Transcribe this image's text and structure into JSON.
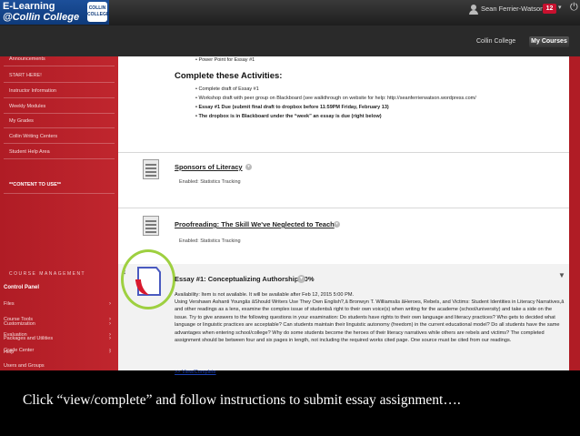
{
  "header": {
    "logo_line1": "E-Learning",
    "logo_line2": "@Collin College",
    "logo_seal_text": "COLLIN COLLEGE",
    "username": "Sean Ferrier-Watson",
    "notification_count": "12",
    "tabs": [
      {
        "label": "Collin College"
      },
      {
        "label": "My Courses"
      }
    ]
  },
  "sidebar": {
    "items": [
      {
        "label": "Announcements"
      },
      {
        "label": "START HERE!"
      },
      {
        "label": "Instructor Information"
      },
      {
        "label": "Weekly Modules"
      },
      {
        "label": "My Grades"
      },
      {
        "label": "Collin Writing Centers"
      },
      {
        "label": "Student Help Area"
      }
    ],
    "content_header": "**CONTENT TO USE**",
    "course_management_label": "COURSE MANAGEMENT",
    "control_panel_label": "Control Panel",
    "control_panel_items": [
      {
        "label": "Files"
      },
      {
        "label": "Course Tools"
      },
      {
        "label": "Evaluation"
      },
      {
        "label": "Grade Center"
      },
      {
        "label": "Users and Groups"
      },
      {
        "label": "Customization"
      },
      {
        "label": "Packages and Utilities"
      },
      {
        "label": "Help"
      }
    ]
  },
  "content": {
    "top_cut_line": "• Power Point for Essay #1",
    "activities_heading": "Complete these Activities:",
    "activities": [
      "• Complete draft of Essay #1",
      "• Workshop draft with peer group on Blackboard (see walkthrough on website for help: http://seanferrierwatson.wordpress.com/",
      "• Essay #1 Due (submit final draft to dropbox before 11:59PM Friday, February 13)",
      "• The dropbox is in Blackboard under the “week” an essay is due (right below)"
    ],
    "items": [
      {
        "title": "Sponsors of Literacy",
        "meta": "Enabled:  Statistics Tracking"
      },
      {
        "title": "Proofreading: The Skill We've Neglected to Teach",
        "meta": "Enabled:  Statistics Tracking"
      }
    ],
    "essay": {
      "title": "Essay #1: Conceptualizing Authorship 10%",
      "availability": "Availability:   Item is not available. It will be available after Feb 12, 2015 5:00 PM.",
      "description": "Using Vershawn Ashanti Youngâs âShould Writers Use They Own English?,â Bronwyn T. Williamsâs âHeroes, Rebels, and Victims: Student Identities in Literacy Narratives,â and other readings as a lens, examine the complex issue of studentsâ right to their own voice(s) when writing for the academe (school/university) and take a side on the issue. Try to give answers to the following questions in your examination: Do students have rights to their own language and literacy practices? Who gets to decided what language or linguistic practices are acceptable? Can students maintain their linguistic autonomy (freedom) in the current educational model? Do all students have the same advantages when entering school/college? Why do some students become the heroes of their literacy narratives while others are rebels and victims? The completed assignment should be between four and six pages in length, not including the required works cited page. One source must be cited from our readings.",
      "link_label": ">> View/Complete"
    }
  },
  "caption": "Click “view/complete” and follow instructions to submit essay assignment…."
}
